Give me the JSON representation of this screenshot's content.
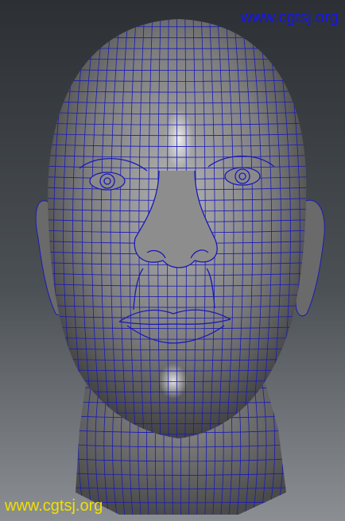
{
  "viewport": {
    "background_top": "#2c3035",
    "background_bottom": "#8b8f94",
    "model_color": "#7d7d7d",
    "wireframe_color": "#1a1ab8",
    "icon": "head-wireframe-icon"
  },
  "watermarks": {
    "top": {
      "text": "www.cgtsj.org",
      "color": "#1515f0"
    },
    "bottom": {
      "text": "www.cgtsj.org",
      "color": "#f0e000"
    }
  }
}
